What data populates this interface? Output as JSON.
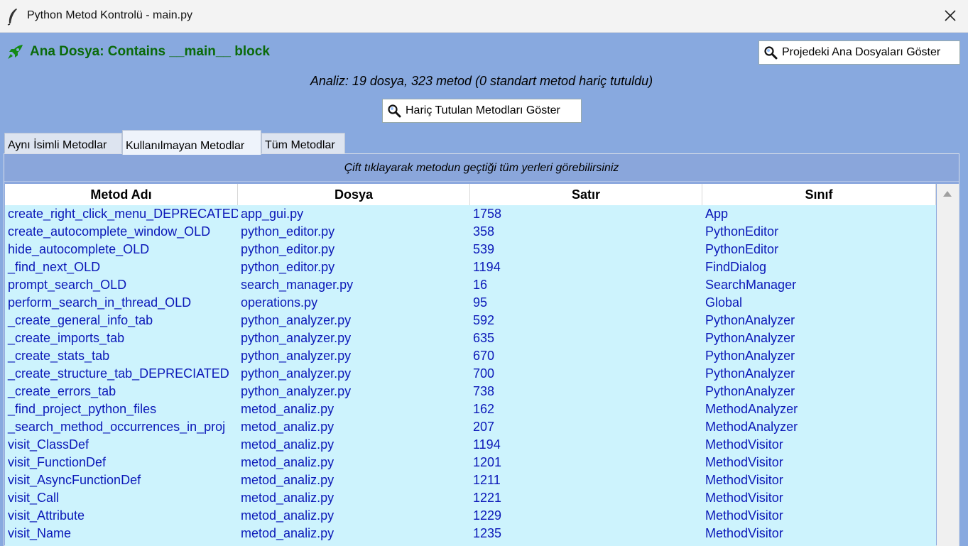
{
  "window": {
    "title": "Python Metod Kontrolü - main.py"
  },
  "header": {
    "main_file_label": "Ana Dosya: Contains __main__ block",
    "show_main_files_button": "Projedeki Ana Dosyaları Göster",
    "analysis_text": "Analiz: 19 dosya, 323 metod (0 standart metod hariç tutuldu)",
    "show_excluded_button": "Hariç Tutulan Metodları Göster"
  },
  "tabs": [
    {
      "label": "Aynı İsimli Metodlar",
      "active": false
    },
    {
      "label": "Kullanılmayan Metodlar",
      "active": true
    },
    {
      "label": "Tüm Metodlar",
      "active": false
    }
  ],
  "panel": {
    "hint": "Çift tıklayarak metodun geçtiği tüm yerleri görebilirsiniz"
  },
  "table": {
    "columns": [
      "Metod Adı",
      "Dosya",
      "Satır",
      "Sınıf"
    ],
    "rows": [
      [
        "create_right_click_menu_DEPRECATED",
        "app_gui.py",
        "1758",
        "App"
      ],
      [
        "create_autocomplete_window_OLD",
        "python_editor.py",
        "358",
        "PythonEditor"
      ],
      [
        "hide_autocomplete_OLD",
        "python_editor.py",
        "539",
        "PythonEditor"
      ],
      [
        "_find_next_OLD",
        "python_editor.py",
        "1194",
        "FindDialog"
      ],
      [
        "prompt_search_OLD",
        "search_manager.py",
        "16",
        "SearchManager"
      ],
      [
        "perform_search_in_thread_OLD",
        "operations.py",
        "95",
        "Global"
      ],
      [
        "_create_general_info_tab",
        "python_analyzer.py",
        "592",
        "PythonAnalyzer"
      ],
      [
        "_create_imports_tab",
        "python_analyzer.py",
        "635",
        "PythonAnalyzer"
      ],
      [
        "_create_stats_tab",
        "python_analyzer.py",
        "670",
        "PythonAnalyzer"
      ],
      [
        "_create_structure_tab_DEPRECIATED",
        "python_analyzer.py",
        "700",
        "PythonAnalyzer"
      ],
      [
        "_create_errors_tab",
        "python_analyzer.py",
        "738",
        "PythonAnalyzer"
      ],
      [
        "_find_project_python_files",
        "metod_analiz.py",
        "162",
        "MethodAnalyzer"
      ],
      [
        "_search_method_occurrences_in_proj",
        "metod_analiz.py",
        "207",
        "MethodAnalyzer"
      ],
      [
        "visit_ClassDef",
        "metod_analiz.py",
        "1194",
        "MethodVisitor"
      ],
      [
        "visit_FunctionDef",
        "metod_analiz.py",
        "1201",
        "MethodVisitor"
      ],
      [
        "visit_AsyncFunctionDef",
        "metod_analiz.py",
        "1211",
        "MethodVisitor"
      ],
      [
        "visit_Call",
        "metod_analiz.py",
        "1221",
        "MethodVisitor"
      ],
      [
        "visit_Attribute",
        "metod_analiz.py",
        "1229",
        "MethodVisitor"
      ],
      [
        "visit_Name",
        "metod_analiz.py",
        "1235",
        "MethodVisitor"
      ]
    ]
  },
  "icons": {
    "app": "feather-icon",
    "close": "close-icon",
    "main_file": "rocket-icon",
    "search": "magnifier-icon",
    "scroll_up": "scroll-up-arrow"
  },
  "colors": {
    "background": "#88a9df",
    "main_file_text": "#0a6a0a",
    "row_background": "#cdf3fd",
    "row_text": "#0b18b8"
  }
}
